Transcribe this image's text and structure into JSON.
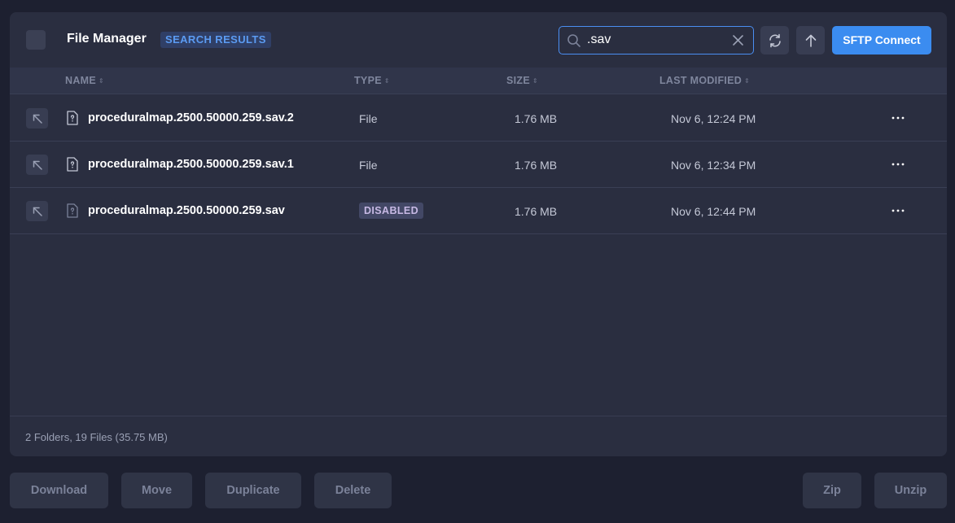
{
  "header": {
    "title": "File Manager",
    "badge": "SEARCH RESULTS",
    "search_value": ".sav",
    "sftp_label": "SFTP Connect"
  },
  "columns": {
    "name": "NAME",
    "type": "TYPE",
    "size": "SIZE",
    "modified": "LAST MODIFIED"
  },
  "files": [
    {
      "name": "proceduralmap.2500.50000.259.sav.2",
      "type": "File",
      "size": "1.76 MB",
      "modified": "Nov 6, 12:24 PM"
    },
    {
      "name": "proceduralmap.2500.50000.259.sav.1",
      "type": "File",
      "size": "1.76 MB",
      "modified": "Nov 6, 12:34 PM"
    },
    {
      "name": "proceduralmap.2500.50000.259.sav",
      "type": "DISABLED",
      "size": "1.76 MB",
      "modified": "Nov 6, 12:44 PM"
    }
  ],
  "summary": "2 Folders, 19 Files (35.75 MB)",
  "actions": {
    "download": "Download",
    "move": "Move",
    "duplicate": "Duplicate",
    "delete": "Delete",
    "zip": "Zip",
    "unzip": "Unzip"
  },
  "colors": {
    "accent": "#3b8cf0",
    "panel": "#2a2e40",
    "background": "#1d2030"
  }
}
